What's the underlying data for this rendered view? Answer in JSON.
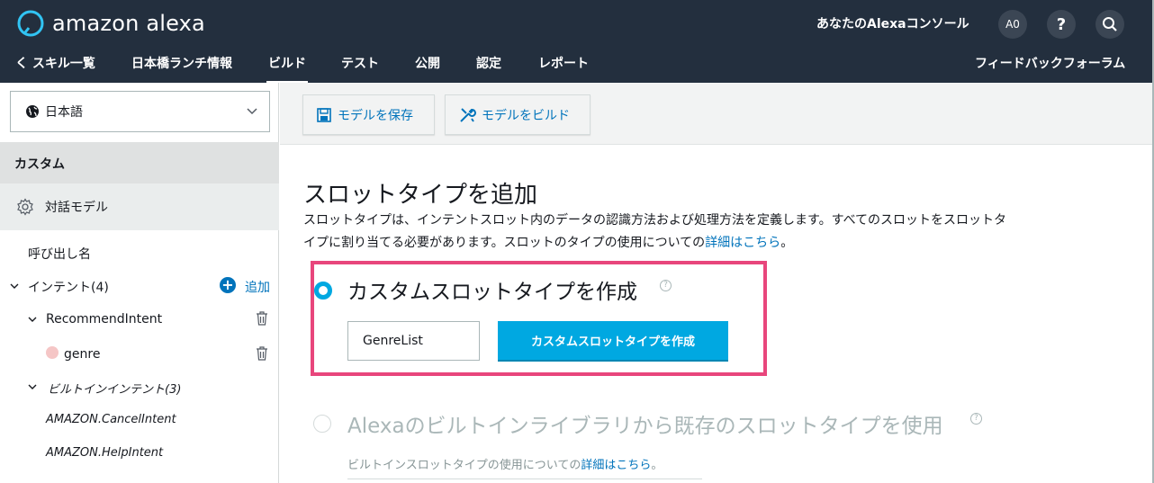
{
  "header": {
    "logo_text": "amazon alexa",
    "console_title": "あなたのAlexaコンソール",
    "user_initials": "A0",
    "help_label": "?"
  },
  "nav": {
    "back": "く スキル一覧",
    "skill_name": "日本橋ランチ情報",
    "tabs": [
      "ビルド",
      "テスト",
      "公開",
      "認定",
      "レポート"
    ],
    "active_tab": "ビルド",
    "forum": "フィードバックフォーラム"
  },
  "sidebar": {
    "language": "日本語",
    "section_custom": "カスタム",
    "dialog_model": "対話モデル",
    "invocation": "呼び出し名",
    "intents": "インテント(4)",
    "add": "追加",
    "recommend_intent": "RecommendIntent",
    "slot_genre": "genre",
    "builtin_intents": "ビルトインインテント(3)",
    "builtin_items": [
      "AMAZON.CancelIntent",
      "AMAZON.HelpIntent"
    ]
  },
  "toolbar": {
    "save": "モデルを保存",
    "build": "モデルをビルド"
  },
  "main": {
    "title": "スロットタイプを追加",
    "desc_line1": "スロットタイプは、インテントスロット内のデータの認識方法および処理方法を定義します。すべてのスロットをスロットタ",
    "desc_line2": "イプに割り当てる必要があります。スロットのタイプの使用についての",
    "desc_link": "詳細はこちら",
    "desc_end": "。",
    "opt1_title": "カスタムスロットタイプを作成",
    "slot_input_value": "GenreList",
    "create_button": "カスタムスロットタイプを作成",
    "opt2_title": "Alexaのビルトインライブラリから既存のスロットタイプを使用",
    "opt2_desc": "ビルトインスロットタイプの使用についての",
    "opt2_link": "詳細はこちら",
    "opt2_end": "。"
  },
  "colors": {
    "header_bg": "#232f3e",
    "accent": "#00a8e1",
    "link": "#0073bb",
    "highlight": "#e8467c"
  }
}
